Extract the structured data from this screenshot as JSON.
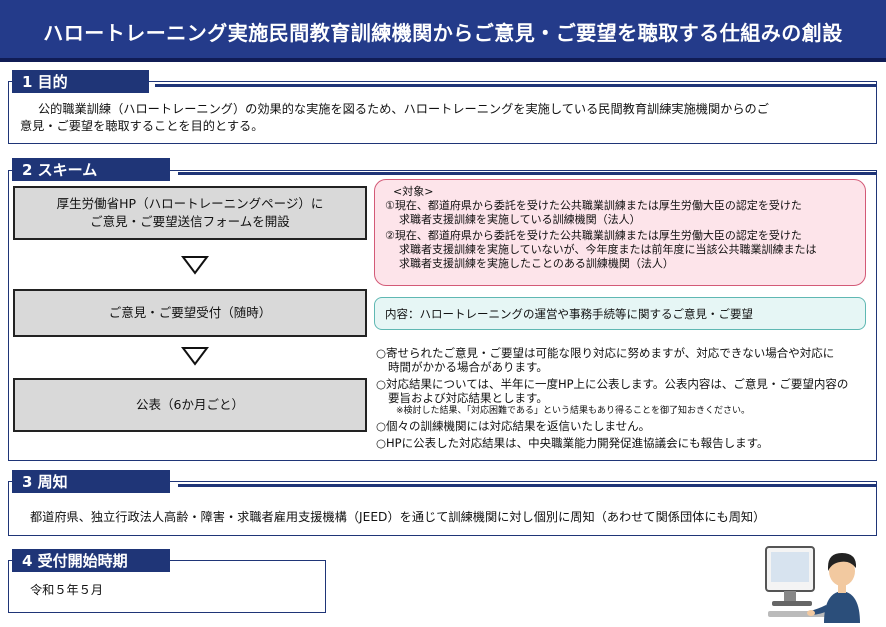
{
  "title": "ハロートレーニング実施民間教育訓練機関からご意見・ご要望を聴取する仕組みの創設",
  "section1": {
    "heading": "1 目的",
    "line1": "公的職業訓練（ハロートレーニング）の効果的な実施を図るため、ハロートレーニングを実施している民間教育訓練実施機関からのご",
    "line2": "意見・ご要望を聴取することを目的とする。"
  },
  "section2": {
    "heading": "2 スキーム",
    "flow": {
      "step1_line1": "厚生労働省HP（ハロートレーニングページ）に",
      "step1_line2": "ご意見・ご要望送信フォームを開設",
      "step2": "ご意見・ご要望受付（随時）",
      "step3": "公表（6か月ごと）"
    },
    "target": {
      "label": "<対象>",
      "item1_line1": "①現在、都道府県から委託を受けた公共職業訓練または厚生労働大臣の認定を受けた",
      "item1_line2": "求職者支援訓練を実施している訓練機関（法人）",
      "item2_line1": "②現在、都道府県から委託を受けた公共職業訓練または厚生労働大臣の認定を受けた",
      "item2_line2": "求職者支援訓練を実施していないが、今年度または前年度に当該公共職業訓練または",
      "item2_line3": "求職者支援訓練を実施したことのある訓練機関（法人）"
    },
    "content": "内容：ハロートレーニングの運営や事務手続等に関するご意見・ご要望",
    "notes": {
      "n1_line1": "○寄せられたご意見・ご要望は可能な限り対応に努めますが、対応できない場合や対応に",
      "n1_line2": "時間がかかる場合があります。",
      "n2_line1": "○対応結果については、半年に一度HP上に公表します。公表内容は、ご意見・ご要望内容の",
      "n2_line2": "要旨および対応結果とします。",
      "n2_small": "※検討した結果、「対応困難である」という結果もあり得ることを御了知おきください。",
      "n3": "○個々の訓練機関には対応結果を返信いたしません。",
      "n4": "○HPに公表した対応結果は、中央職業能力開発促進協議会にも報告します。"
    }
  },
  "section3": {
    "heading": "3 周知",
    "text": "都道府県、独立行政法人高齢・障害・求職者雇用支援機構（JEED）を通じて訓練機関に対し個別に周知（あわせて関係団体にも周知）"
  },
  "section4": {
    "heading": "4 受付開始時期",
    "text": "令和５年５月"
  },
  "colors": {
    "navy": "#1f3577",
    "title_bg": "#243b8a",
    "target_bg": "#fde4ea",
    "target_border": "#d35a77",
    "content_bg": "#e6f6f5",
    "content_border": "#5fb8b3"
  },
  "icons": {
    "arrow": "down-triangle-icon",
    "illustration": "person-at-computer-icon"
  }
}
